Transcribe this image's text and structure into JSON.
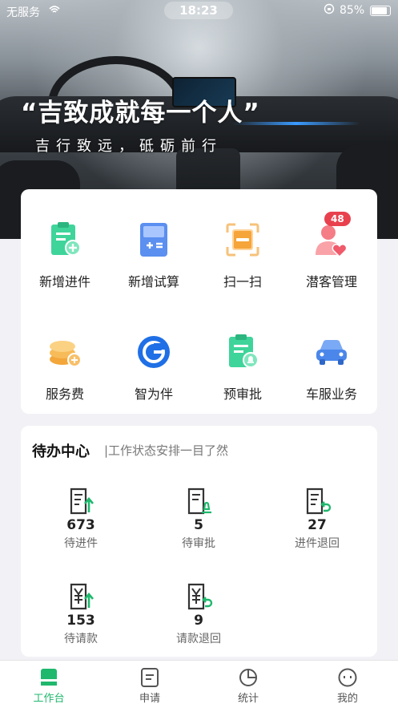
{
  "status_bar": {
    "carrier": "无服务",
    "time": "18:23",
    "battery": "85%",
    "battery_level": 0.85
  },
  "hero": {
    "slogan": "“吉致成就每一个人”",
    "subslogan": "吉行致远，砥砺前行"
  },
  "quick_actions": [
    {
      "label": "新增进件",
      "icon": "new-application-icon"
    },
    {
      "label": "新增试算",
      "icon": "calculator-icon"
    },
    {
      "label": "扫一扫",
      "icon": "scan-icon"
    },
    {
      "label": "潜客管理",
      "icon": "potential-customer-icon",
      "badge": "48"
    },
    {
      "label": "服务费",
      "icon": "service-fee-coins-icon"
    },
    {
      "label": "智为伴",
      "icon": "g-logo-icon"
    },
    {
      "label": "预审批",
      "icon": "pre-approval-icon"
    },
    {
      "label": "车服业务",
      "icon": "car-service-icon"
    }
  ],
  "todo": {
    "title": "待办中心",
    "subtitle": "|工作状态安排一目了然",
    "items": [
      {
        "count": "673",
        "label": "待进件",
        "icon": "document-up-icon"
      },
      {
        "count": "5",
        "label": "待审批",
        "icon": "document-approve-icon"
      },
      {
        "count": "27",
        "label": "进件退回",
        "icon": "document-return-icon"
      },
      {
        "count": "153",
        "label": "待请款",
        "icon": "yen-document-up-icon"
      },
      {
        "count": "9",
        "label": "请款退回",
        "icon": "yen-document-return-icon"
      }
    ]
  },
  "tabbar": {
    "tabs": [
      {
        "label": "工作台",
        "icon": "workbench-icon",
        "active": true
      },
      {
        "label": "申请",
        "icon": "apply-icon"
      },
      {
        "label": "统计",
        "icon": "statistics-icon"
      },
      {
        "label": "我的",
        "icon": "profile-icon"
      }
    ]
  },
  "colors": {
    "accent": "#1fb86d",
    "badge": "#e8414d"
  }
}
